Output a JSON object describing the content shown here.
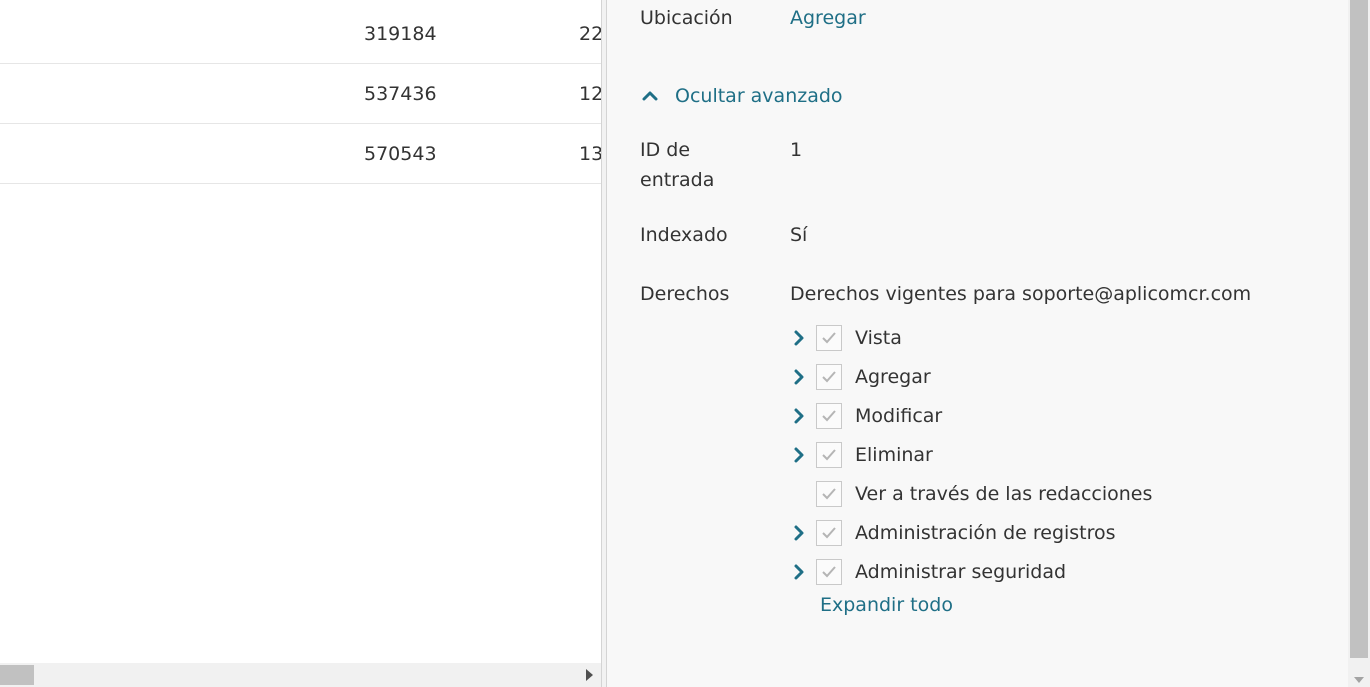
{
  "table": {
    "rows": [
      {
        "col_a": "319184",
        "col_b": "22"
      },
      {
        "col_a": "537436",
        "col_b": "12"
      },
      {
        "col_a": "570543",
        "col_b": "13"
      }
    ]
  },
  "details": {
    "location_label": "Ubicación",
    "location_action": "Agregar",
    "toggle_advanced_label": "Ocultar avanzado",
    "entry_id_label": "ID de entrada",
    "entry_id_value": "1",
    "indexed_label": "Indexado",
    "indexed_value": "Sí",
    "rights_label": "Derechos",
    "rights_heading": "Derechos vigentes para soporte@aplicomcr.com",
    "rights": [
      {
        "label": "Vista",
        "expandable": true,
        "checked": true
      },
      {
        "label": "Agregar",
        "expandable": true,
        "checked": true
      },
      {
        "label": "Modificar",
        "expandable": true,
        "checked": true
      },
      {
        "label": "Eliminar",
        "expandable": true,
        "checked": true
      },
      {
        "label": "Ver a través de las redacciones",
        "expandable": false,
        "checked": true
      },
      {
        "label": "Administración de registros",
        "expandable": true,
        "checked": true
      },
      {
        "label": "Administrar seguridad",
        "expandable": true,
        "checked": true
      }
    ],
    "expand_all_label": "Expandir todo"
  },
  "colors": {
    "link": "#1f6f86",
    "text": "#333333",
    "pane_bg": "#f8f8f8",
    "checkmark": "#b5b5b5"
  },
  "icons": {
    "toggle": "chevron-up-icon",
    "expand": "chevron-right-icon",
    "check": "check-icon"
  }
}
